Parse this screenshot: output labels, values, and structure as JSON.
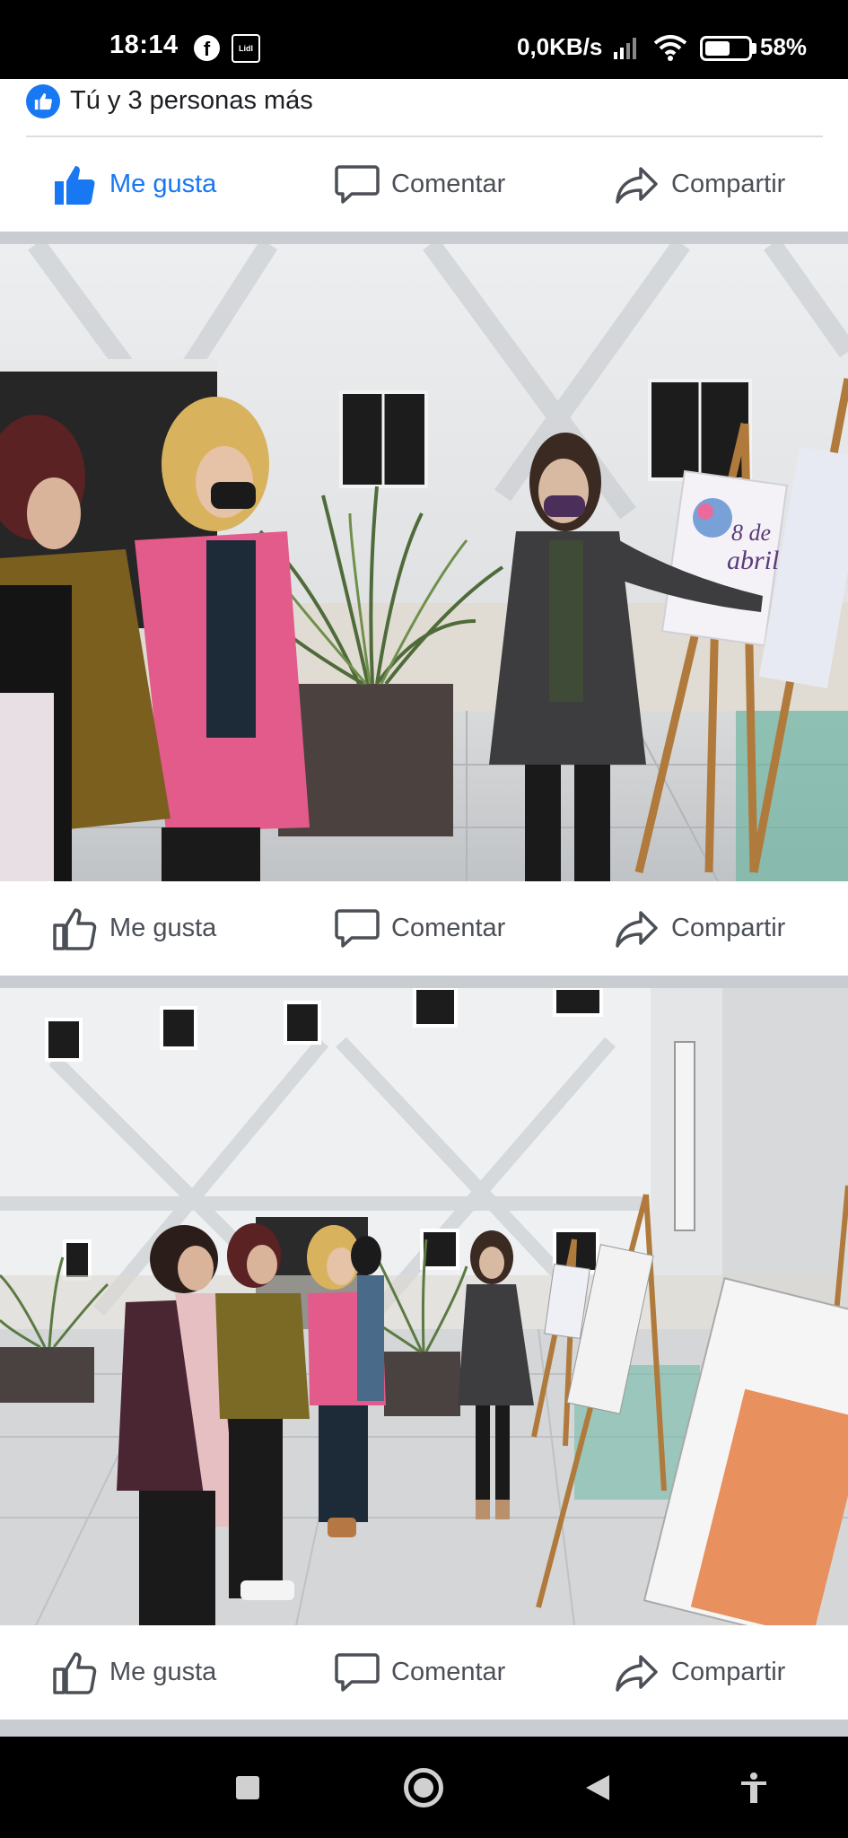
{
  "status_bar": {
    "time": "18:14",
    "fb_icon": "facebook-icon",
    "lidl_icon": "lidl-icon",
    "lidl_text": "Lidl",
    "net_speed": "0,0KB/s",
    "battery_percent": "58%",
    "battery_level": 0.58
  },
  "post": {
    "reactions_summary": "Tú y 3 personas más",
    "reaction_icon": "like-badge-icon"
  },
  "actions": {
    "like_label": "Me gusta",
    "comment_label": "Comentar",
    "share_label": "Compartir"
  },
  "photo1": {
    "poster_line1": "8 de",
    "poster_line2": "abril"
  },
  "colors": {
    "facebook_blue": "#1877f2",
    "action_grey": "#4b4f56",
    "separator": "#c9ccd1"
  },
  "nav_bar": {
    "icons": [
      "recents-square-icon",
      "home-circle-icon",
      "back-triangle-icon",
      "accessibility-icon"
    ]
  }
}
